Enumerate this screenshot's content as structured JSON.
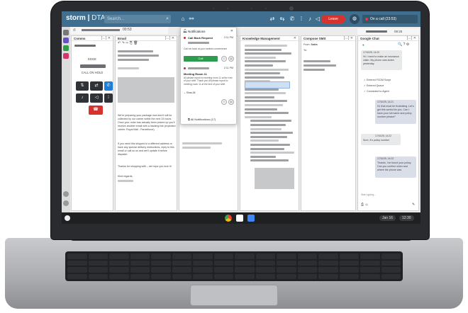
{
  "brand": {
    "logo": "storm",
    "logo_suffix": "DTA",
    "search_placeholder": "Search..."
  },
  "topbar": {
    "end_button": "Leave",
    "on_call": "On a call (23:53)"
  },
  "session": {
    "timer": "00:53",
    "right_timer": "09:25"
  },
  "panels": {
    "comms": {
      "title": "Comms"
    },
    "email": {
      "title": "Email"
    },
    "knowledge": {
      "title": "Knowledge Management"
    },
    "compose": {
      "title": "Compose SMS",
      "from_label": "From:",
      "from_value": "Sales",
      "to_label": "To:"
    },
    "chat": {
      "title": "Google Chat"
    }
  },
  "dialer": {
    "status_primary": "EDGE",
    "status_secondary": "CALL ON HOLD"
  },
  "notifications": {
    "title": "Notifications",
    "item1": {
      "title": "Call Back Request",
      "time": "2:11 PM",
      "sub": "Call me back at your earliest convenience",
      "call_label": "Call"
    },
    "item2": {
      "time": "2:11 PM",
      "title": "Meeting Room 11",
      "body": "All please report to meeting room 11 at the end of your shift. Thank you All please report to meeting room 11 at the end of your shift.",
      "show_all": "Show All"
    },
    "footer": "All Notifications (17)"
  },
  "email_body": {
    "p1": "We're preparing your package now and it will be collected by our carrier within the next 24 hours. Once your order has actually been picked up you'll receive another email with a tracking link (expected carrier: Royal Mail - Parcelforce).",
    "p2": "If you need this shipped to a different address or have any special delivery instructions, reply to this email or call us on and we'll update it before dispatch.",
    "p3": "Thanks for shopping with – we hope you love it!",
    "p4": "Kind regards,"
  },
  "chat": {
    "t1": "17/10/25, 14:20",
    "m1": "Hi, I need to make an insurance claim. My phone was stolen yesterday.",
    "e1": "Entered FCDM Script",
    "e2": "Entered Queue",
    "e3": "Connected to Agent",
    "t2": "17/10/25, 14:21",
    "m2": "Hi, that must be frustrating. Let's get this sorted for you. Can I have your full name and policy number please?",
    "t3": "17/10/25, 14:22",
    "m3": "Sure, it's policy number",
    "t4": "17/10/25, 14:23",
    "m4": "Thanks, I've found your policy. Can you confirm when and where the phone was",
    "placeholder": "Start typing..."
  },
  "shelf": {
    "date": "Jan 16",
    "time": "12:30"
  }
}
